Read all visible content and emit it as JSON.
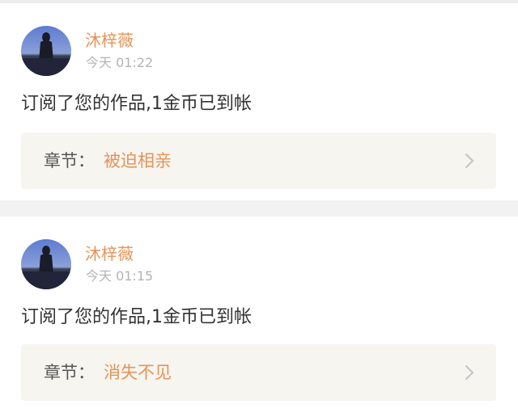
{
  "notifications": [
    {
      "username": "沐梓薇",
      "time": "今天 01:22",
      "message": "订阅了您的作品,1金币已到帐",
      "chapter_label": "章节：",
      "chapter_title": "被迫相亲"
    },
    {
      "username": "沐梓薇",
      "time": "今天 01:15",
      "message": "订阅了您的作品,1金币已到帐",
      "chapter_label": "章节：",
      "chapter_title": "消失不见"
    }
  ],
  "colors": {
    "accent": "#e4945a",
    "timestamp": "#b4b4b4",
    "text": "#333333",
    "chapter_bg": "#f6f5f0",
    "page_bg": "#f2f2f2"
  },
  "icons": {
    "avatar": "avatar-silhouette-icon",
    "chevron": "chevron-right-icon"
  }
}
